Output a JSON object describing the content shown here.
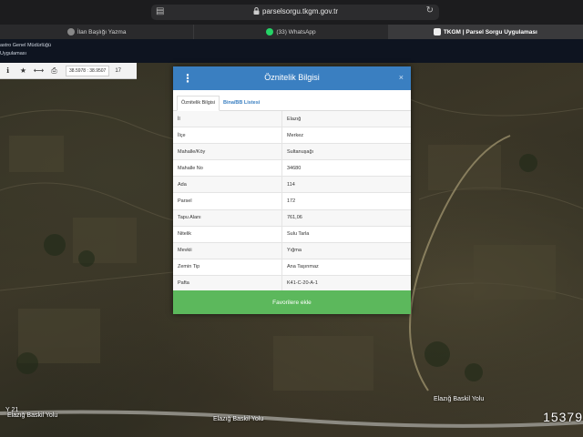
{
  "browser": {
    "url": "parselsorgu.tkgm.gov.tr",
    "tabs": [
      {
        "label": "İlan Başlığı Yazma",
        "active": false
      },
      {
        "label": "(33) WhatsApp",
        "active": false
      },
      {
        "label": "TKGM | Parsel Sorgu Uygulaması",
        "active": true
      }
    ]
  },
  "site_header": {
    "line1": "astro Genel Müdürlüğü",
    "line2": "Uygulaması"
  },
  "toolbar": {
    "coords": "38.5978 : 38.9507",
    "zoom": "17"
  },
  "map": {
    "road_labels": [
      "Elazığ Baskil Yolu",
      "Elazığ Baskil Yolu",
      "Elazığ Baskil Yolu"
    ],
    "left_label": "Y 21",
    "scale_number": "15379"
  },
  "modal": {
    "title": "Öznitelik Bilgisi",
    "close": "×",
    "tabs": [
      "Öznitelik Bilgisi",
      "Bina/BB Listesi"
    ],
    "rows": [
      {
        "key": "İl",
        "value": "Elazığ"
      },
      {
        "key": "İlçe",
        "value": "Merkez"
      },
      {
        "key": "Mahalle/Köy",
        "value": "Sultanuşağı"
      },
      {
        "key": "Mahalle No",
        "value": "34680"
      },
      {
        "key": "Ada",
        "value": "114"
      },
      {
        "key": "Parsel",
        "value": "172"
      },
      {
        "key": "Tapu Alanı",
        "value": "761,06"
      },
      {
        "key": "Nitelik",
        "value": "Sulu Tarla"
      },
      {
        "key": "Mevkii",
        "value": "Yığma"
      },
      {
        "key": "Zemin Tip",
        "value": "Ana Taşınmaz"
      },
      {
        "key": "Pafta",
        "value": "K41-C-20-A-1"
      }
    ],
    "favorite_button": "Favorilere ekle"
  },
  "colors": {
    "header_blue": "#3a7fc1",
    "button_green": "#5cb85c"
  }
}
